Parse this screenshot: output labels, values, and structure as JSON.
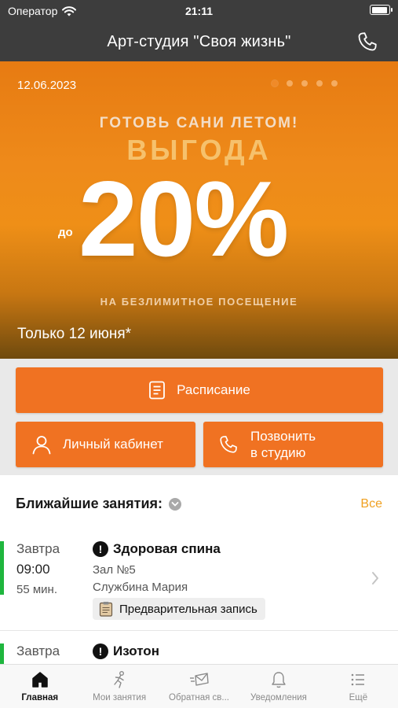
{
  "status_bar": {
    "carrier": "Оператор",
    "time": "21:11"
  },
  "header": {
    "title": "Арт-студия \"Своя жизнь\"",
    "phone_icon": "phone-icon"
  },
  "banner": {
    "date": "12.06.2023",
    "slides_count": 5,
    "active_slide": 1,
    "promo_line1": "ГОТОВЬ САНИ ЛЕТОМ!",
    "promo_line2": "ВЫГОДА",
    "promo_prefix": "до",
    "promo_value": "20%",
    "promo_line3": "НА БЕЗЛИМИТНОЕ ПОСЕЩЕНИЕ",
    "promo_note": "Только 12 июня*",
    "colors": {
      "gradient_top": "#e77b12",
      "gradient_bottom": "#6f4a0e"
    }
  },
  "actions": {
    "schedule": {
      "label": "Расписание",
      "icon": "schedule-icon"
    },
    "cabinet": {
      "label": "Личный кабинет",
      "icon": "user-icon"
    },
    "call": {
      "label_line1": "Позвонить",
      "label_line2": "в студию",
      "icon": "phone-icon"
    },
    "accent_color": "#f07222"
  },
  "upcoming": {
    "title": "Ближайшие занятия:",
    "see_all": "Все",
    "lessons": [
      {
        "day": "Завтра",
        "time": "09:00",
        "duration": "55 мин.",
        "name": "Здоровая спина",
        "hall": "Зал №5",
        "teacher": "Службина Мария",
        "badge": "Предварительная запись",
        "status_color": "#1fb63e"
      },
      {
        "day": "Завтра",
        "name": "Изотон",
        "status_color": "#1fb63e"
      }
    ]
  },
  "tabbar": {
    "items": [
      {
        "label": "Главная",
        "icon": "home-icon",
        "active": true
      },
      {
        "label": "Мои занятия",
        "icon": "activity-icon",
        "active": false
      },
      {
        "label": "Обратная св...",
        "icon": "feedback-icon",
        "active": false
      },
      {
        "label": "Уведомления",
        "icon": "bell-icon",
        "active": false
      },
      {
        "label": "Ещё",
        "icon": "more-icon",
        "active": false
      }
    ]
  }
}
